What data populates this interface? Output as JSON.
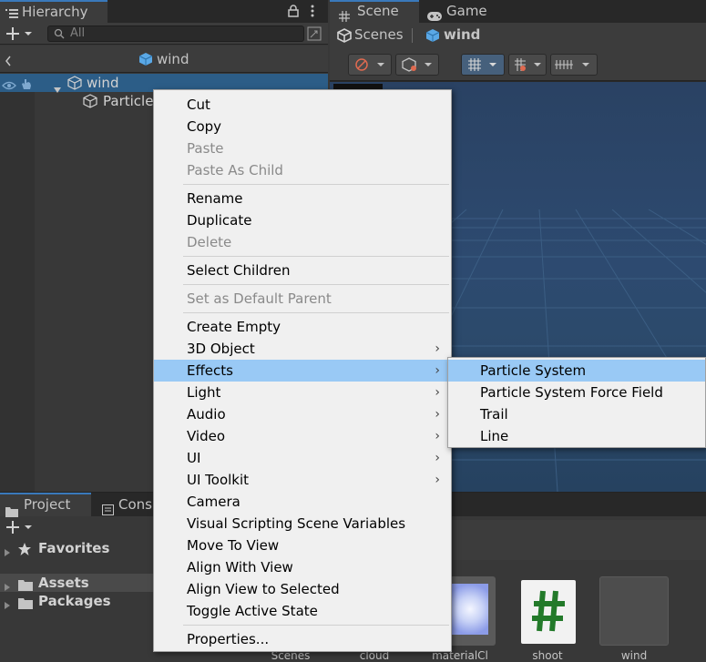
{
  "hierarchy": {
    "tab_label": "Hierarchy",
    "search_placeholder": "All",
    "breadcrumb": "wind",
    "rows": [
      {
        "label": "wind"
      },
      {
        "label": "Particle"
      }
    ]
  },
  "scene": {
    "tabs": [
      {
        "label": "Scene"
      },
      {
        "label": "Game"
      }
    ],
    "breadcrumb_root": "Scenes",
    "breadcrumb_item": "wind"
  },
  "project": {
    "tabs": [
      {
        "label": "Project"
      },
      {
        "label": "Cons"
      }
    ],
    "tree": [
      {
        "label": "Favorites"
      },
      {
        "label": "Assets"
      },
      {
        "label": "Packages"
      }
    ],
    "assets": [
      {
        "label": "Scenes"
      },
      {
        "label": "cloud"
      },
      {
        "label": "materialCl"
      },
      {
        "label": "shoot"
      },
      {
        "label": "wind"
      }
    ]
  },
  "context_menu": {
    "items": [
      {
        "label": "Cut"
      },
      {
        "label": "Copy"
      },
      {
        "label": "Paste"
      },
      {
        "label": "Paste As Child"
      },
      {
        "label": "Rename"
      },
      {
        "label": "Duplicate"
      },
      {
        "label": "Delete"
      },
      {
        "label": "Select Children"
      },
      {
        "label": "Set as Default Parent"
      },
      {
        "label": "Create Empty"
      },
      {
        "label": "3D Object"
      },
      {
        "label": "Effects"
      },
      {
        "label": "Light"
      },
      {
        "label": "Audio"
      },
      {
        "label": "Video"
      },
      {
        "label": "UI"
      },
      {
        "label": "UI Toolkit"
      },
      {
        "label": "Camera"
      },
      {
        "label": "Visual Scripting Scene Variables"
      },
      {
        "label": "Move To View"
      },
      {
        "label": "Align With View"
      },
      {
        "label": "Align View to Selected"
      },
      {
        "label": "Toggle Active State"
      },
      {
        "label": "Properties..."
      }
    ]
  },
  "effects_submenu": {
    "items": [
      {
        "label": "Particle System"
      },
      {
        "label": "Particle System Force Field"
      },
      {
        "label": "Trail"
      },
      {
        "label": "Line"
      }
    ]
  },
  "colors": {
    "selection": "#99c9f5",
    "panel": "#383838",
    "menu_bg": "#f0f0f0",
    "accent": "#3a79bb"
  }
}
